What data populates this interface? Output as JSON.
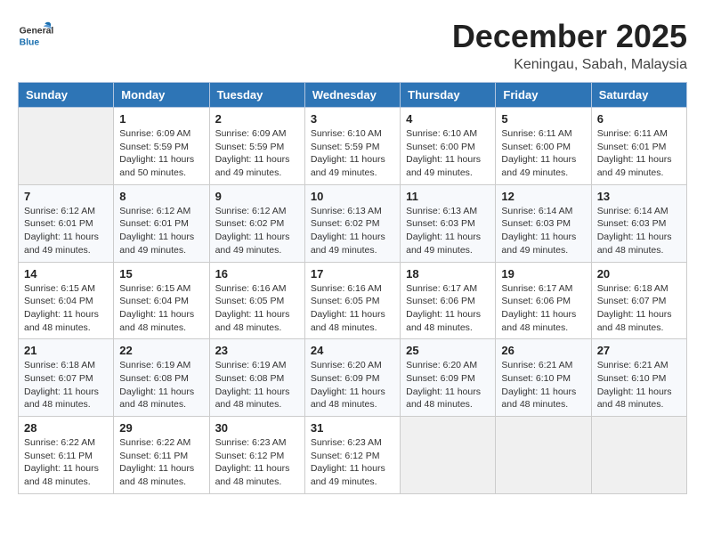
{
  "header": {
    "logo_general": "General",
    "logo_blue": "Blue",
    "month_title": "December 2025",
    "subtitle": "Keningau, Sabah, Malaysia"
  },
  "days_of_week": [
    "Sunday",
    "Monday",
    "Tuesday",
    "Wednesday",
    "Thursday",
    "Friday",
    "Saturday"
  ],
  "weeks": [
    [
      {
        "day": "",
        "info": ""
      },
      {
        "day": "1",
        "info": "Sunrise: 6:09 AM\nSunset: 5:59 PM\nDaylight: 11 hours\nand 50 minutes."
      },
      {
        "day": "2",
        "info": "Sunrise: 6:09 AM\nSunset: 5:59 PM\nDaylight: 11 hours\nand 49 minutes."
      },
      {
        "day": "3",
        "info": "Sunrise: 6:10 AM\nSunset: 5:59 PM\nDaylight: 11 hours\nand 49 minutes."
      },
      {
        "day": "4",
        "info": "Sunrise: 6:10 AM\nSunset: 6:00 PM\nDaylight: 11 hours\nand 49 minutes."
      },
      {
        "day": "5",
        "info": "Sunrise: 6:11 AM\nSunset: 6:00 PM\nDaylight: 11 hours\nand 49 minutes."
      },
      {
        "day": "6",
        "info": "Sunrise: 6:11 AM\nSunset: 6:01 PM\nDaylight: 11 hours\nand 49 minutes."
      }
    ],
    [
      {
        "day": "7",
        "info": "Sunrise: 6:12 AM\nSunset: 6:01 PM\nDaylight: 11 hours\nand 49 minutes."
      },
      {
        "day": "8",
        "info": "Sunrise: 6:12 AM\nSunset: 6:01 PM\nDaylight: 11 hours\nand 49 minutes."
      },
      {
        "day": "9",
        "info": "Sunrise: 6:12 AM\nSunset: 6:02 PM\nDaylight: 11 hours\nand 49 minutes."
      },
      {
        "day": "10",
        "info": "Sunrise: 6:13 AM\nSunset: 6:02 PM\nDaylight: 11 hours\nand 49 minutes."
      },
      {
        "day": "11",
        "info": "Sunrise: 6:13 AM\nSunset: 6:03 PM\nDaylight: 11 hours\nand 49 minutes."
      },
      {
        "day": "12",
        "info": "Sunrise: 6:14 AM\nSunset: 6:03 PM\nDaylight: 11 hours\nand 49 minutes."
      },
      {
        "day": "13",
        "info": "Sunrise: 6:14 AM\nSunset: 6:03 PM\nDaylight: 11 hours\nand 48 minutes."
      }
    ],
    [
      {
        "day": "14",
        "info": "Sunrise: 6:15 AM\nSunset: 6:04 PM\nDaylight: 11 hours\nand 48 minutes."
      },
      {
        "day": "15",
        "info": "Sunrise: 6:15 AM\nSunset: 6:04 PM\nDaylight: 11 hours\nand 48 minutes."
      },
      {
        "day": "16",
        "info": "Sunrise: 6:16 AM\nSunset: 6:05 PM\nDaylight: 11 hours\nand 48 minutes."
      },
      {
        "day": "17",
        "info": "Sunrise: 6:16 AM\nSunset: 6:05 PM\nDaylight: 11 hours\nand 48 minutes."
      },
      {
        "day": "18",
        "info": "Sunrise: 6:17 AM\nSunset: 6:06 PM\nDaylight: 11 hours\nand 48 minutes."
      },
      {
        "day": "19",
        "info": "Sunrise: 6:17 AM\nSunset: 6:06 PM\nDaylight: 11 hours\nand 48 minutes."
      },
      {
        "day": "20",
        "info": "Sunrise: 6:18 AM\nSunset: 6:07 PM\nDaylight: 11 hours\nand 48 minutes."
      }
    ],
    [
      {
        "day": "21",
        "info": "Sunrise: 6:18 AM\nSunset: 6:07 PM\nDaylight: 11 hours\nand 48 minutes."
      },
      {
        "day": "22",
        "info": "Sunrise: 6:19 AM\nSunset: 6:08 PM\nDaylight: 11 hours\nand 48 minutes."
      },
      {
        "day": "23",
        "info": "Sunrise: 6:19 AM\nSunset: 6:08 PM\nDaylight: 11 hours\nand 48 minutes."
      },
      {
        "day": "24",
        "info": "Sunrise: 6:20 AM\nSunset: 6:09 PM\nDaylight: 11 hours\nand 48 minutes."
      },
      {
        "day": "25",
        "info": "Sunrise: 6:20 AM\nSunset: 6:09 PM\nDaylight: 11 hours\nand 48 minutes."
      },
      {
        "day": "26",
        "info": "Sunrise: 6:21 AM\nSunset: 6:10 PM\nDaylight: 11 hours\nand 48 minutes."
      },
      {
        "day": "27",
        "info": "Sunrise: 6:21 AM\nSunset: 6:10 PM\nDaylight: 11 hours\nand 48 minutes."
      }
    ],
    [
      {
        "day": "28",
        "info": "Sunrise: 6:22 AM\nSunset: 6:11 PM\nDaylight: 11 hours\nand 48 minutes."
      },
      {
        "day": "29",
        "info": "Sunrise: 6:22 AM\nSunset: 6:11 PM\nDaylight: 11 hours\nand 48 minutes."
      },
      {
        "day": "30",
        "info": "Sunrise: 6:23 AM\nSunset: 6:12 PM\nDaylight: 11 hours\nand 48 minutes."
      },
      {
        "day": "31",
        "info": "Sunrise: 6:23 AM\nSunset: 6:12 PM\nDaylight: 11 hours\nand 49 minutes."
      },
      {
        "day": "",
        "info": ""
      },
      {
        "day": "",
        "info": ""
      },
      {
        "day": "",
        "info": ""
      }
    ]
  ]
}
